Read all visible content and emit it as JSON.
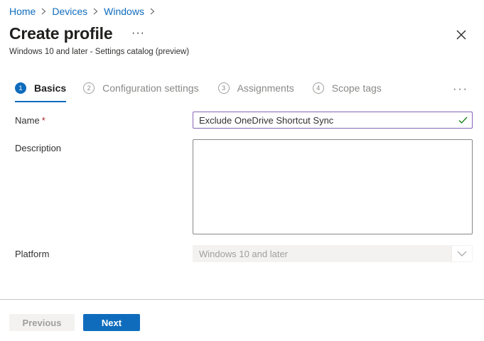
{
  "breadcrumb": {
    "items": [
      "Home",
      "Devices",
      "Windows"
    ]
  },
  "header": {
    "title": "Create profile",
    "more": "···",
    "subtitle": "Windows 10 and later - Settings catalog (preview)"
  },
  "steps": [
    {
      "num": "1",
      "label": "Basics",
      "active": true
    },
    {
      "num": "2",
      "label": "Configuration settings"
    },
    {
      "num": "3",
      "label": "Assignments"
    },
    {
      "num": "4",
      "label": "Scope tags"
    }
  ],
  "steps_more": "···",
  "form": {
    "name_label": "Name",
    "required_mark": "*",
    "name_value": "Exclude OneDrive Shortcut Sync",
    "description_label": "Description",
    "description_value": "",
    "platform_label": "Platform",
    "platform_value": "Windows 10 and later"
  },
  "footer": {
    "previous": "Previous",
    "next": "Next"
  },
  "colors": {
    "accent": "#0f6cbd",
    "focus_border": "#8764b8",
    "success": "#107c10",
    "required": "#a4262c"
  },
  "icons": {
    "crumb_sep": "chevron-right-icon",
    "close": "close-icon",
    "check": "checkmark-icon",
    "dropdown": "chevron-down-icon"
  }
}
